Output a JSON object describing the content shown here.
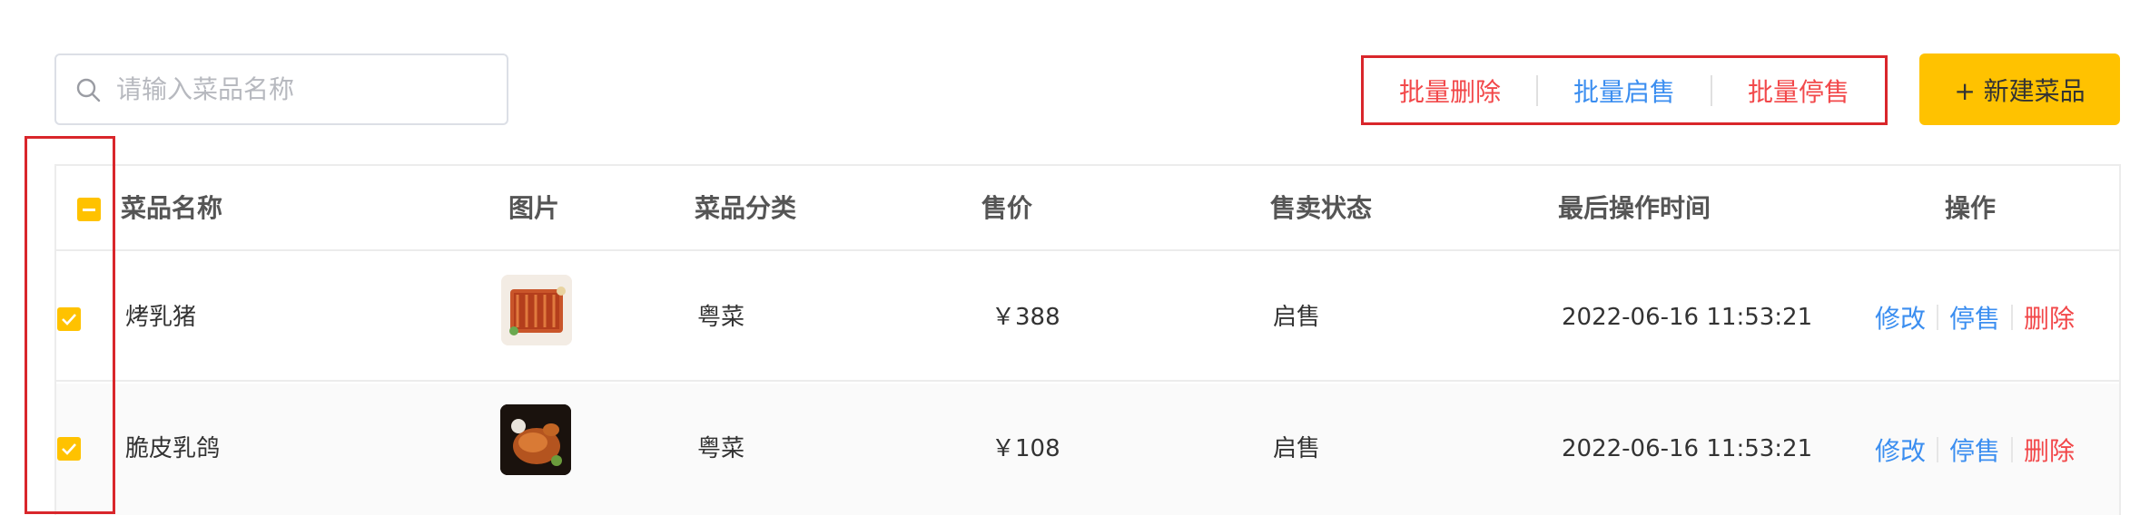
{
  "search": {
    "placeholder": "请输入菜品名称",
    "value": ""
  },
  "batch": {
    "delete": "批量删除",
    "enable": "批量启售",
    "disable": "批量停售"
  },
  "new_button": "+ 新建菜品",
  "table": {
    "columns": [
      "菜品名称",
      "图片",
      "菜品分类",
      "售价",
      "售卖状态",
      "最后操作时间",
      "操作"
    ],
    "rows": [
      {
        "name": "烤乳猪",
        "category": "粤菜",
        "price": "￥388",
        "status": "启售",
        "time": "2022-06-16 11:53:21",
        "checked": true
      },
      {
        "name": "脆皮乳鸽",
        "category": "粤菜",
        "price": "￥108",
        "status": "启售",
        "time": "2022-06-16 11:53:21",
        "checked": true
      }
    ],
    "actions": {
      "edit": "修改",
      "disable": "停售",
      "delete": "删除"
    }
  },
  "colors": {
    "accent": "#ffc200",
    "danger": "#f2484a",
    "link": "#3b8ef0",
    "highlight": "#d9262b"
  }
}
